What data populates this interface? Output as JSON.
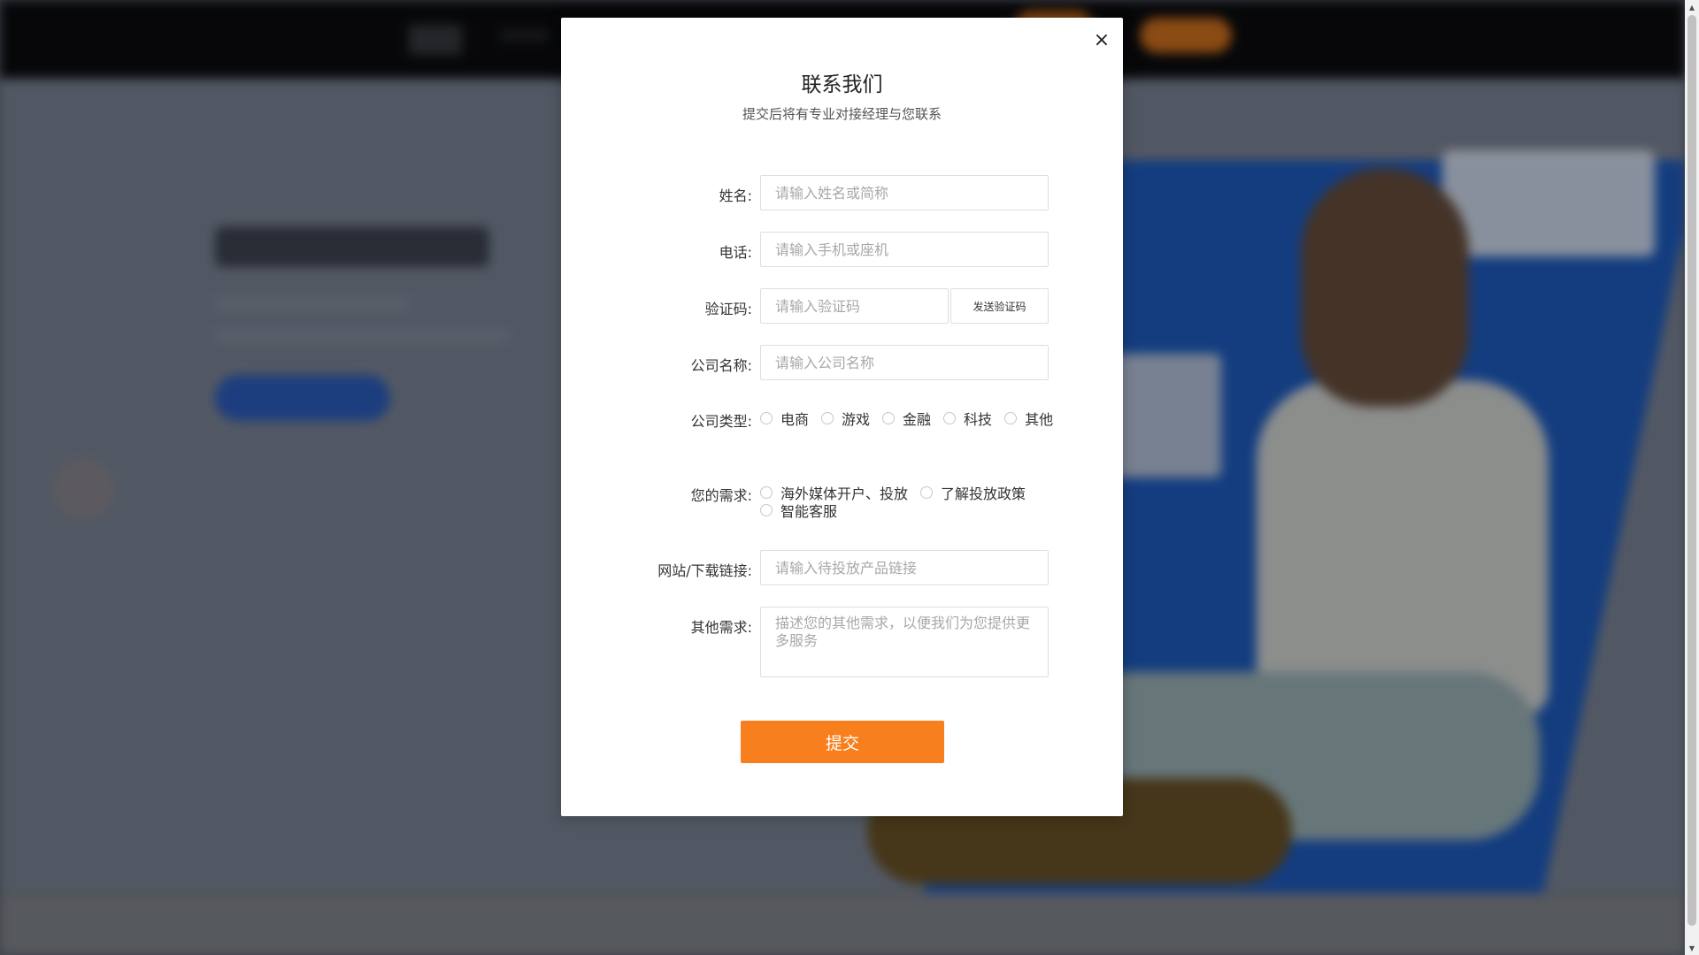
{
  "modal": {
    "title": "联系我们",
    "subtitle": "提交后将有专业对接经理与您联系",
    "close_label": "×"
  },
  "form": {
    "name": {
      "label": "姓名:",
      "placeholder": "请输入姓名或简称",
      "value": ""
    },
    "phone": {
      "label": "电话:",
      "placeholder": "请输入手机或座机",
      "value": ""
    },
    "code": {
      "label": "验证码:",
      "placeholder": "请输入验证码",
      "value": "",
      "send_button": "发送验证码"
    },
    "company_name": {
      "label": "公司名称:",
      "placeholder": "请输入公司名称",
      "value": ""
    },
    "company_type": {
      "label": "公司类型:",
      "options": [
        "电商",
        "游戏",
        "金融",
        "科技",
        "其他"
      ],
      "selected": null
    },
    "needs": {
      "label": "您的需求:",
      "options": [
        "海外媒体开户、投放",
        "了解投放政策",
        "智能客服"
      ],
      "selected": null
    },
    "website": {
      "label": "网站/下载链接:",
      "placeholder": "请输入待投放产品链接",
      "value": ""
    },
    "other": {
      "label": "其他需求:",
      "placeholder": "描述您的其他需求，以便我们为您提供更多服务",
      "value": ""
    },
    "submit_label": "提交"
  },
  "colors": {
    "accent": "#f77f1e",
    "overlay": "rgba(0,0,0,0.35)",
    "background_blue": "#1f5ec4"
  },
  "scrollbar": {
    "up_icon": "▲",
    "down_icon": "▼"
  }
}
